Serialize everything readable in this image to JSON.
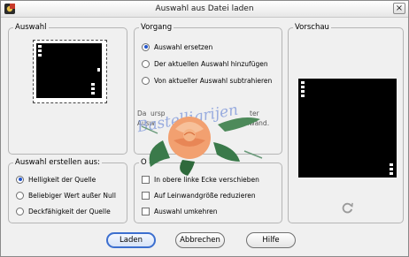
{
  "window": {
    "title": "Auswahl aus Datei laden"
  },
  "groups": {
    "auswahl": {
      "legend": "Auswahl"
    },
    "vorgang": {
      "legend": "Vorgang",
      "options": [
        {
          "label": "Auswahl ersetzen",
          "selected": true
        },
        {
          "label": "Der aktuellen Auswahl hinzufügen",
          "selected": false
        },
        {
          "label": "Von aktueller Auswahl subtrahieren",
          "selected": false
        }
      ],
      "info_fragments": [
        "Da",
        "ursp",
        "ter",
        "Ausw",
        "einwand."
      ]
    },
    "erstellen": {
      "legend": "Auswahl erstellen aus:",
      "options": [
        {
          "label": "Helligkeit der Quelle",
          "selected": true
        },
        {
          "label": "Beliebiger Wert außer Null",
          "selected": false
        },
        {
          "label": "Deckfähigkeit der Quelle",
          "selected": false
        }
      ]
    },
    "optionen": {
      "legend": "O",
      "checks": [
        {
          "label": "In obere linke Ecke verschieben",
          "checked": false
        },
        {
          "label": "Auf Leinwandgröße reduzieren",
          "checked": false
        },
        {
          "label": "Auswahl umkehren",
          "checked": false
        }
      ]
    },
    "vorschau": {
      "legend": "Vorschau"
    }
  },
  "watermark": {
    "text": "Bastelligrijen"
  },
  "buttons": {
    "ok": "Laden",
    "cancel": "Abbrechen",
    "help": "Hilfe"
  },
  "icons": {
    "app": "paint-shop-app-icon",
    "refresh": "refresh-icon",
    "close": "close-icon",
    "decoration": "rose-icon"
  },
  "colors": {
    "accent": "#2255cc",
    "rose": "#f2a070",
    "leaf": "#3a7a4a"
  }
}
